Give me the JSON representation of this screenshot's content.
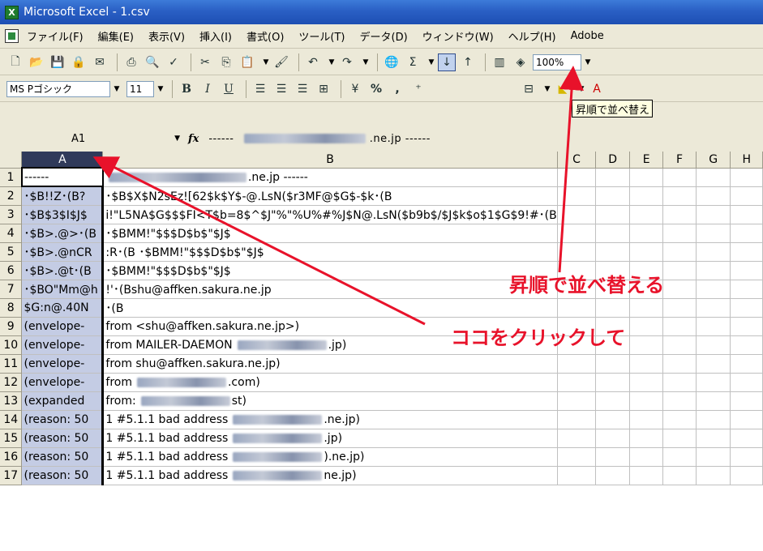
{
  "window": {
    "title": "Microsoft Excel - 1.csv"
  },
  "menu": [
    "ファイル(F)",
    "編集(E)",
    "表示(V)",
    "挿入(I)",
    "書式(O)",
    "ツール(T)",
    "データ(D)",
    "ウィンドウ(W)",
    "ヘルプ(H)",
    "Adobe"
  ],
  "toolbar": {
    "zoom": "100%",
    "font_name": "MS Pゴシック",
    "font_size": "11",
    "bold": "B",
    "italic": "I",
    "underline": "U",
    "percent": "%",
    "comma": ","
  },
  "tooltip": "昇順で並べ替え",
  "formula": {
    "name_box": "A1",
    "fx": "fx",
    "prefix": "------",
    "suffix": ".ne.jp ------"
  },
  "columns": [
    "A",
    "B",
    "C",
    "D",
    "E",
    "F",
    "G",
    "H"
  ],
  "rows": [
    {
      "n": "1",
      "a": "------",
      "b": ".ne.jp ------"
    },
    {
      "n": "2",
      "a": "･$B!!Z･(B?",
      "b": "･$B$X$N2sEz![62$k$Y$-@.LsN($r3MF@$G$-$k･(B"
    },
    {
      "n": "3",
      "a": "･$B$3$I$J$",
      "b": "i!\"L5NA$G$$$FI<T$b=8$^$J\"%\"%U%#%J$N@.LsN($b9b$/$J$k$o$1$G$9!#･(B"
    },
    {
      "n": "4",
      "a": "･$B>.@>･(B",
      "b": "･$BMM!\"$$$D$b$\"$J$"
    },
    {
      "n": "5",
      "a": "･$B>.@nCR",
      "b": ":R･(B ･$BMM!\"$$$D$b$\"$J$"
    },
    {
      "n": "6",
      "a": "･$B>.@t･(B",
      "b": "･$BMM!\"$$$D$b$\"$J$"
    },
    {
      "n": "7",
      "a": "･$BO\"Mm@h",
      "b": "!'･(Bshu@affken.sakura.ne.jp"
    },
    {
      "n": "8",
      "a": "$G:n@.40N",
      "b": "･(B"
    },
    {
      "n": "9",
      "a": "(envelope-",
      "b": "from <shu@affken.sakura.ne.jp>)"
    },
    {
      "n": "10",
      "a": "(envelope-",
      "b": "from MAILER-DAEMON",
      "c": ".jp)"
    },
    {
      "n": "11",
      "a": "(envelope-",
      "b": "from shu@affken.sakura.ne.jp)"
    },
    {
      "n": "12",
      "a": "(envelope-",
      "b": "from",
      "c": ".com)"
    },
    {
      "n": "13",
      "a": "(expanded",
      "b": "from:",
      "c": "st)"
    },
    {
      "n": "14",
      "a": "(reason: 50",
      "b": "1 #5.1.1 bad address",
      "c": ".ne.jp)"
    },
    {
      "n": "15",
      "a": "(reason: 50",
      "b": "1 #5.1.1 bad address",
      "c": ".jp)"
    },
    {
      "n": "16",
      "a": "(reason: 50",
      "b": "1 #5.1.1 bad address",
      "c": ").ne.jp)"
    },
    {
      "n": "17",
      "a": "(reason: 50",
      "b": "1 #5.1.1 bad address",
      "c": "ne.jp)"
    }
  ],
  "annotations": {
    "sort_label": "昇順で並べ替える",
    "click_label": "ココをクリックして",
    "color": "#e8122a"
  }
}
